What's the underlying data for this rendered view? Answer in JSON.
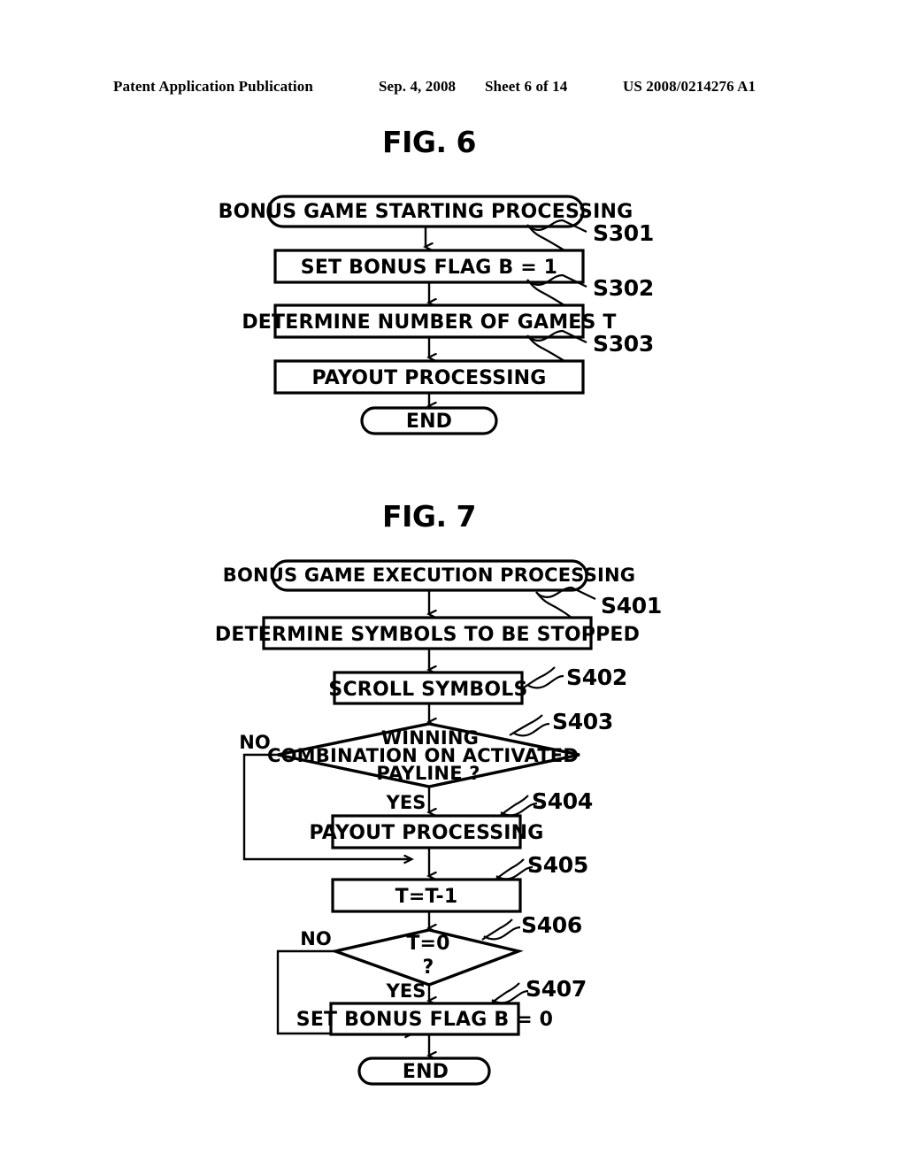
{
  "header": {
    "publication": "Patent Application Publication",
    "date": "Sep. 4, 2008",
    "sheet": "Sheet 6 of 14",
    "patent_number": "US 2008/0214276 A1"
  },
  "figures": [
    {
      "title": "FIG. 6",
      "nodes": {
        "start": "BONUS GAME STARTING PROCESSING",
        "s301": "SET BONUS FLAG B = 1",
        "s302": "DETERMINE NUMBER OF GAMES T",
        "s303": "PAYOUT PROCESSING",
        "end": "END"
      },
      "step_labels": {
        "s301": "S301",
        "s302": "S302",
        "s303": "S303"
      }
    },
    {
      "title": "FIG. 7",
      "nodes": {
        "start": "BONUS GAME EXECUTION PROCESSING",
        "s401": "DETERMINE SYMBOLS TO BE STOPPED",
        "s402": "SCROLL SYMBOLS",
        "s403_line1": "WINNING",
        "s403_line2": "COMBINATION ON ACTIVATED",
        "s403_line3": "PAYLINE ?",
        "s404": "PAYOUT PROCESSING",
        "s405": "T=T-1",
        "s406_line1": "T=0",
        "s406_line2": "?",
        "s407": "SET BONUS FLAG B = 0",
        "end": "END"
      },
      "step_labels": {
        "s401": "S401",
        "s402": "S402",
        "s403": "S403",
        "s404": "S404",
        "s405": "S405",
        "s406": "S406",
        "s407": "S407"
      },
      "branch_labels": {
        "s403_no": "NO",
        "s403_yes": "YES",
        "s406_no": "NO",
        "s406_yes": "YES"
      }
    }
  ],
  "colors": {
    "ink": "#000000",
    "paper": "#ffffff"
  }
}
